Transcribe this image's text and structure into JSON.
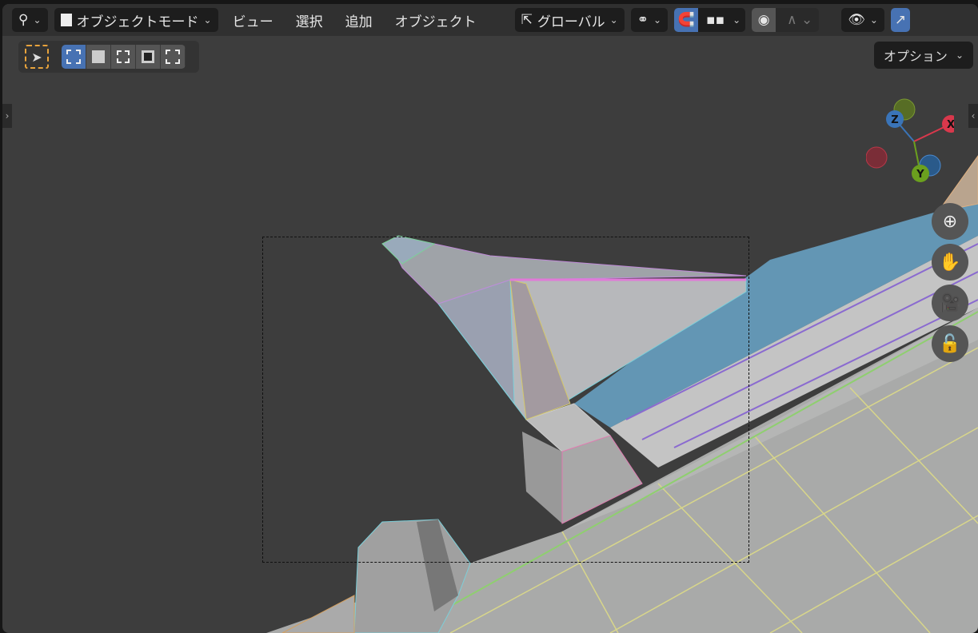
{
  "header": {
    "mode_label": "オブジェクトモード",
    "menus": [
      "ビュー",
      "選択",
      "追加",
      "オブジェクト"
    ],
    "transform_orientation": "グローバル"
  },
  "toolbar": {
    "options_label": "オプション"
  },
  "gizmo": {
    "x_label": "X",
    "y_label": "Y",
    "z_label": "Z"
  },
  "colors": {
    "accent": "#4772b3",
    "x_axis": "#d9384c",
    "y_axis": "#6ba01e",
    "z_axis": "#3a74b8",
    "select_tool": "#e8a33c"
  }
}
